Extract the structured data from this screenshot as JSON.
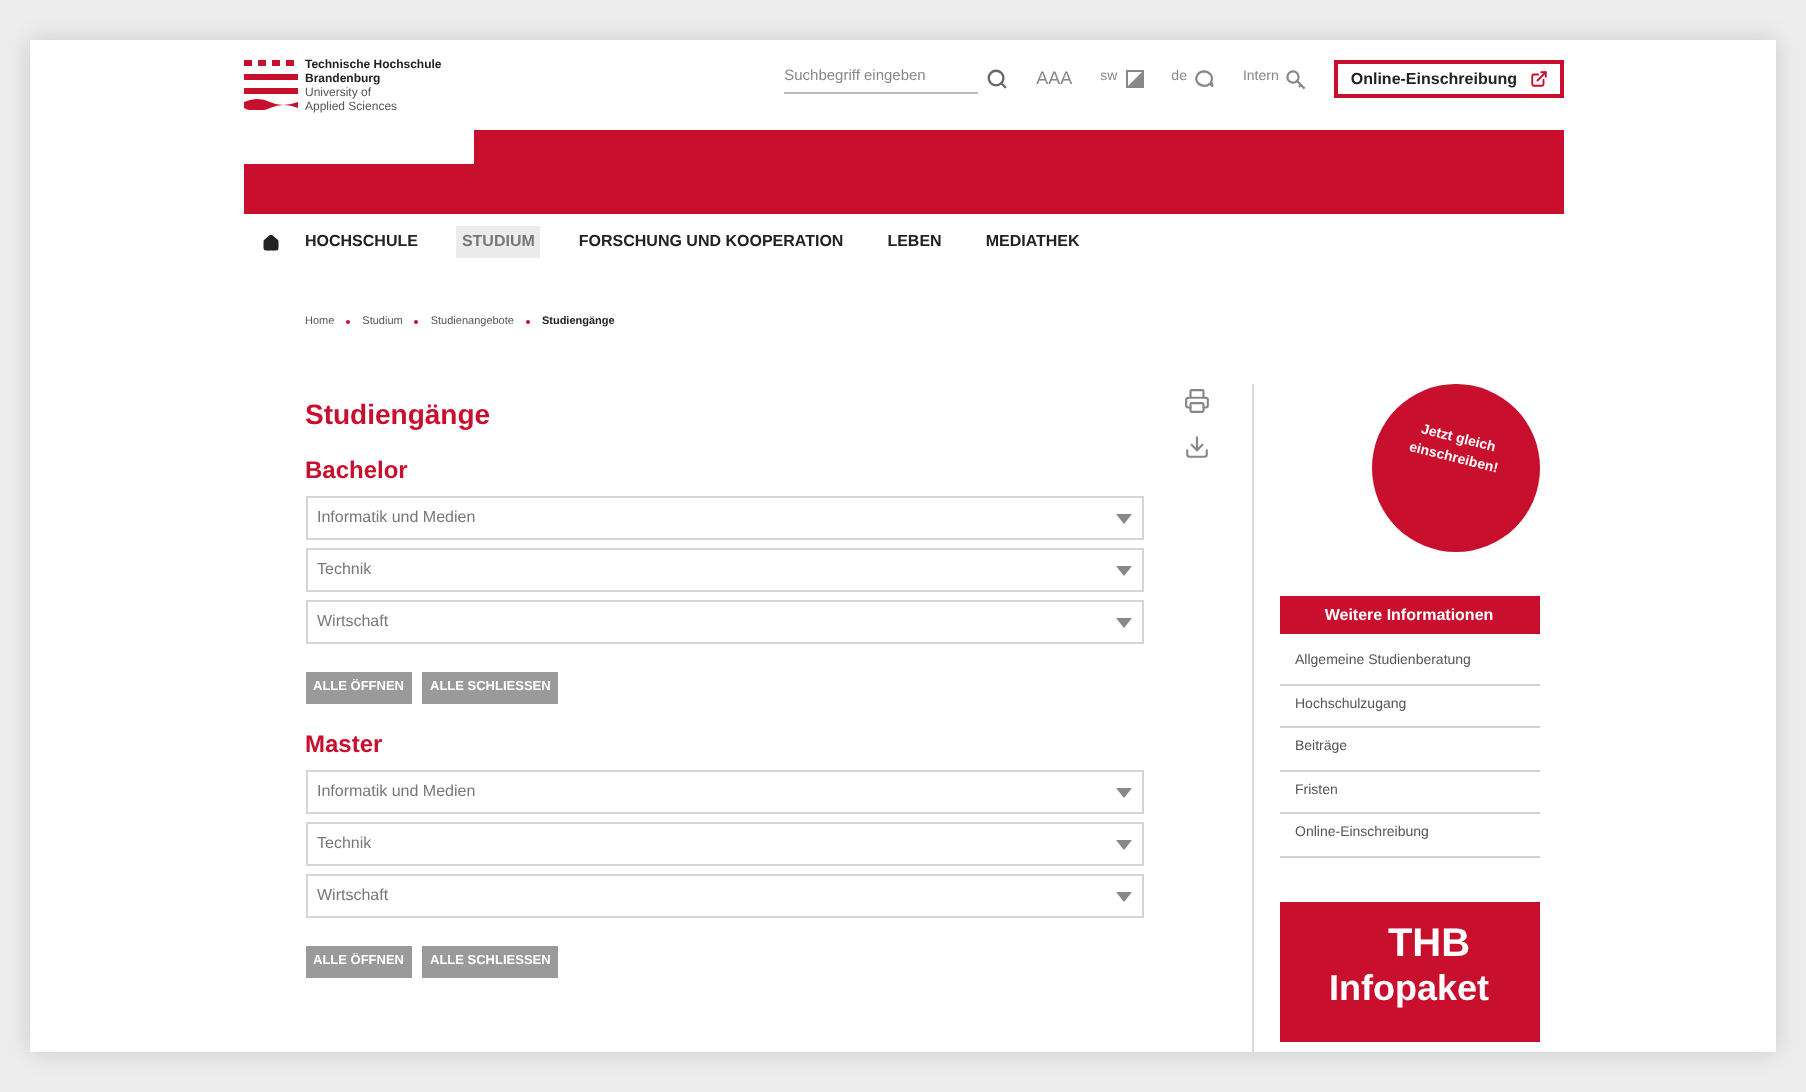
{
  "logo": {
    "lines": [
      "Technische Hochschule",
      "Brandenburg",
      "University of",
      "Applied Sciences"
    ]
  },
  "search": {
    "placeholder": "Suchbegriff eingeben"
  },
  "font_size_label": "AAA",
  "contrast_label": "sw",
  "language_label": "de",
  "intern_label": "Intern",
  "enroll_button": "Online-Einschreibung",
  "nav": [
    {
      "label": "HOCHSCHULE",
      "selected": false
    },
    {
      "label": "STUDIUM",
      "selected": true
    },
    {
      "label": "FORSCHUNG UND KOOPERATION",
      "selected": false
    },
    {
      "label": "LEBEN",
      "selected": false
    },
    {
      "label": "MEDIATHEK",
      "selected": false
    }
  ],
  "breadcrumb": [
    {
      "label": "Home",
      "current": false
    },
    {
      "label": "Studium",
      "current": false
    },
    {
      "label": "Studienangebote",
      "current": false
    },
    {
      "label": "Studiengänge",
      "current": true
    }
  ],
  "page_title": "Studiengänge",
  "sections": [
    {
      "title": "Bachelor",
      "items": [
        {
          "label": "Informatik und Medien",
          "expanded": false
        },
        {
          "label": "Technik",
          "expanded": false
        },
        {
          "label": "Wirtschaft",
          "expanded": false
        }
      ],
      "buttons": [
        "ALLE ÖFFNEN",
        "ALLE SCHLIESSEN"
      ]
    },
    {
      "title": "Master",
      "items": [
        {
          "label": "Informatik und Medien",
          "expanded": false
        },
        {
          "label": "Technik",
          "expanded": false
        },
        {
          "label": "Wirtschaft",
          "expanded": false
        }
      ],
      "buttons": [
        "ALLE ÖFFNEN",
        "ALLE SCHLIESSEN"
      ]
    }
  ],
  "badge": {
    "lines": [
      "Jetzt gleich",
      "einschreiben!"
    ]
  },
  "more_info": {
    "title": "Weitere Informationen",
    "links": [
      "Allgemeine Studienberatung",
      "Hochschulzugang",
      "Beiträge",
      "Fristen",
      "Online-Einschreibung"
    ]
  },
  "promo": {
    "lines": [
      "THB",
      "Infopaket"
    ]
  }
}
